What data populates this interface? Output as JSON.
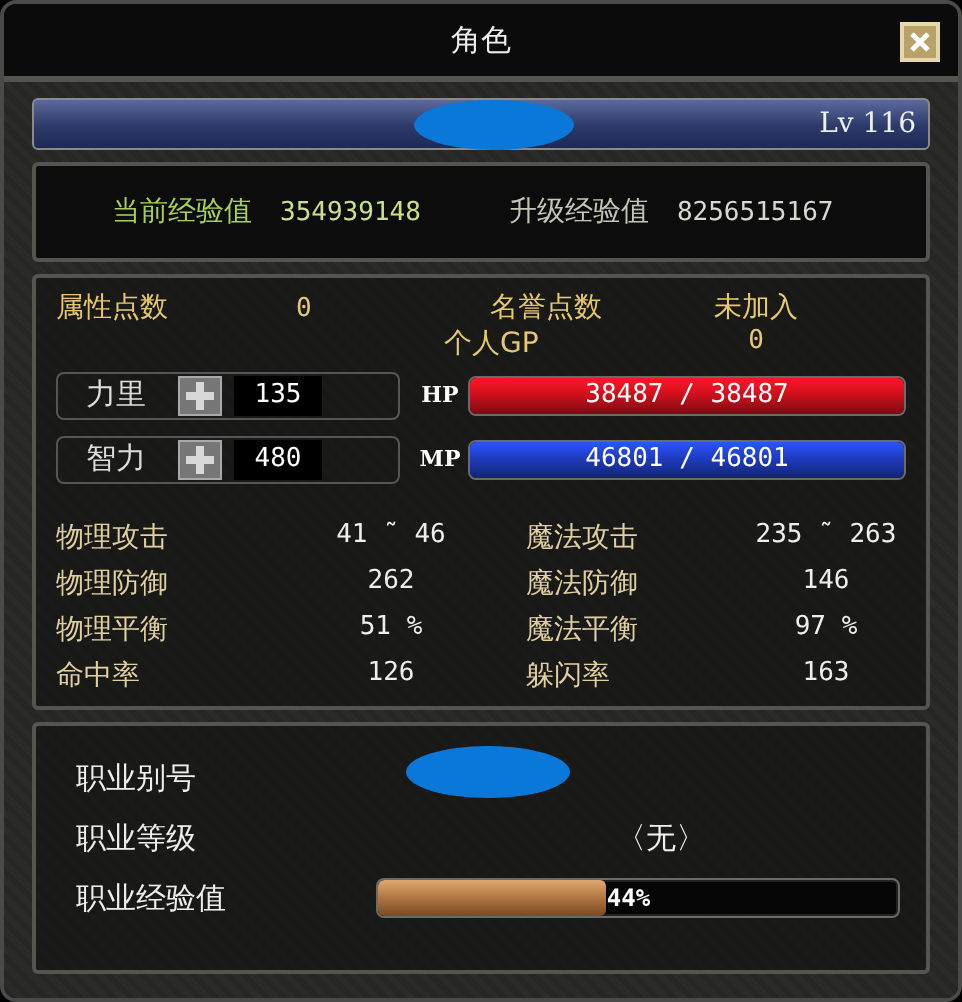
{
  "window": {
    "title": "角色"
  },
  "name_bar": {
    "level": "Lv 116"
  },
  "experience": {
    "current_label": "当前经验值",
    "current_value": "354939148",
    "next_label": "升级经验值",
    "next_value": "8256515167"
  },
  "points": {
    "attribute_label": "属性点数",
    "attribute_value": "0",
    "honor_label": "名誉点数",
    "honor_value": "未加入",
    "gp_label": "个人GP",
    "gp_value": "0"
  },
  "base_stats": [
    {
      "label": "力里",
      "value": "135",
      "bar_label": "HP",
      "reading": "38487 / 38487",
      "level": 1.0,
      "color": "#d0101c"
    },
    {
      "label": "智力",
      "value": "480",
      "bar_label": "MP",
      "reading": "46801 / 46801",
      "level": 1.0,
      "color": "#1e3cc0"
    }
  ],
  "stats": [
    {
      "label": "物理攻击",
      "value": "41 ˜ 46"
    },
    {
      "label": "魔法攻击",
      "value": "235 ˜ 263"
    },
    {
      "label": "物理防御",
      "value": "262"
    },
    {
      "label": "魔法防御",
      "value": "146"
    },
    {
      "label": "物理平衡",
      "value": "51 %"
    },
    {
      "label": "魔法平衡",
      "value": "97 %"
    },
    {
      "label": "命中率",
      "value": "126"
    },
    {
      "label": "躲闪率",
      "value": "163"
    }
  ],
  "job": {
    "alias_label": "职业别号",
    "rank_label": "职业等级",
    "rank_value": "〈无〉",
    "exp_label": "职业经验值",
    "level": 0.44,
    "reading": "44%"
  }
}
